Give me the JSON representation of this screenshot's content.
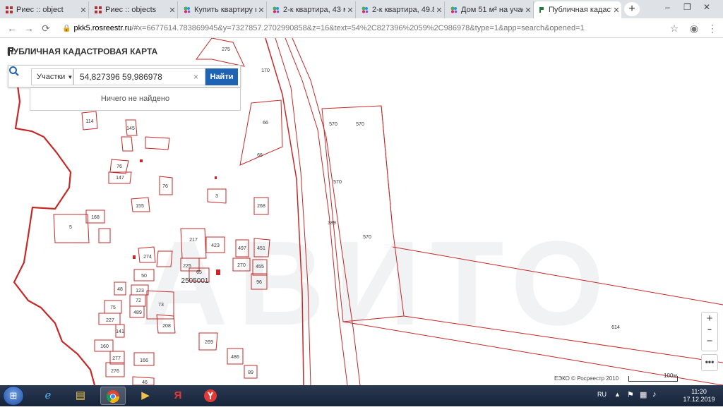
{
  "browser": {
    "tabs": [
      {
        "title": "Риес :: object",
        "active": false,
        "favicon": "riees-favicon"
      },
      {
        "title": "Риес :: objects",
        "active": false,
        "favicon": "riees-favicon"
      },
      {
        "title": "Купить квартиру в",
        "active": false,
        "favicon": "avito-favicon"
      },
      {
        "title": "2-к квартира, 43 м",
        "active": false,
        "favicon": "avito-favicon"
      },
      {
        "title": "2-к квартира, 49.8",
        "active": false,
        "favicon": "avito-favicon"
      },
      {
        "title": "Дом 51 м² на учас",
        "active": false,
        "favicon": "avito-favicon"
      },
      {
        "title": "Публичная кадаст",
        "active": true,
        "favicon": "pkk-favicon"
      }
    ],
    "new_tab_label": "+",
    "url_domain": "pkk5.rosreestr.ru",
    "url_path": "/#x=6677614.783869945&y=7327857.2702990858&z=16&text=54%2C827396%2059%2C986978&type=1&app=search&opened=1"
  },
  "app": {
    "title": "ПУБЛИЧНАЯ КАДАСТРОВАЯ КАРТА",
    "search": {
      "type_label": "Участки",
      "query": "54,827396 59,986978",
      "clear_label": "×",
      "find_label": "Найти",
      "no_result": "Ничего не найдено"
    },
    "zoom_in": "+",
    "zoom_out": "−",
    "more_label": "•••",
    "attribution": "ЕЭКО © Росреестр 2010",
    "scale_label": "100м",
    "watermark": "АВИТО"
  },
  "parcels": [
    {
      "label": "275"
    },
    {
      "label": "170"
    },
    {
      "label": "66"
    },
    {
      "label": "66"
    },
    {
      "label": "570"
    },
    {
      "label": "570"
    },
    {
      "label": "570"
    },
    {
      "label": "570"
    },
    {
      "label": "114"
    },
    {
      "label": "145"
    },
    {
      "label": "76"
    },
    {
      "label": "147"
    },
    {
      "label": "76"
    },
    {
      "label": "3"
    },
    {
      "label": "155"
    },
    {
      "label": "268"
    },
    {
      "label": "168"
    },
    {
      "label": "5"
    },
    {
      "label": "389"
    },
    {
      "label": "217"
    },
    {
      "label": "423"
    },
    {
      "label": "497"
    },
    {
      "label": "451"
    },
    {
      "label": "274"
    },
    {
      "label": "225"
    },
    {
      "label": "65"
    },
    {
      "label": "270"
    },
    {
      "label": "455"
    },
    {
      "label": "50"
    },
    {
      "label": "2505001"
    },
    {
      "label": "96"
    },
    {
      "label": "48"
    },
    {
      "label": "123"
    },
    {
      "label": "72"
    },
    {
      "label": "73"
    },
    {
      "label": "75"
    },
    {
      "label": "489"
    },
    {
      "label": "227"
    },
    {
      "label": "141"
    },
    {
      "label": "208"
    },
    {
      "label": "269"
    },
    {
      "label": "614"
    },
    {
      "label": "160"
    },
    {
      "label": "277"
    },
    {
      "label": "166"
    },
    {
      "label": "486"
    },
    {
      "label": "276"
    },
    {
      "label": "89"
    },
    {
      "label": "46"
    }
  ],
  "taskbar": {
    "lang": "RU",
    "time": "11:20",
    "date": "17.12.2019",
    "icons": [
      "ie-icon",
      "explorer-icon",
      "chrome-icon",
      "media-player-icon",
      "yandex-icon",
      "yandex-browser-icon"
    ]
  },
  "colors": {
    "parcel_stroke": "#c62828",
    "accent": "#1f63b5"
  }
}
